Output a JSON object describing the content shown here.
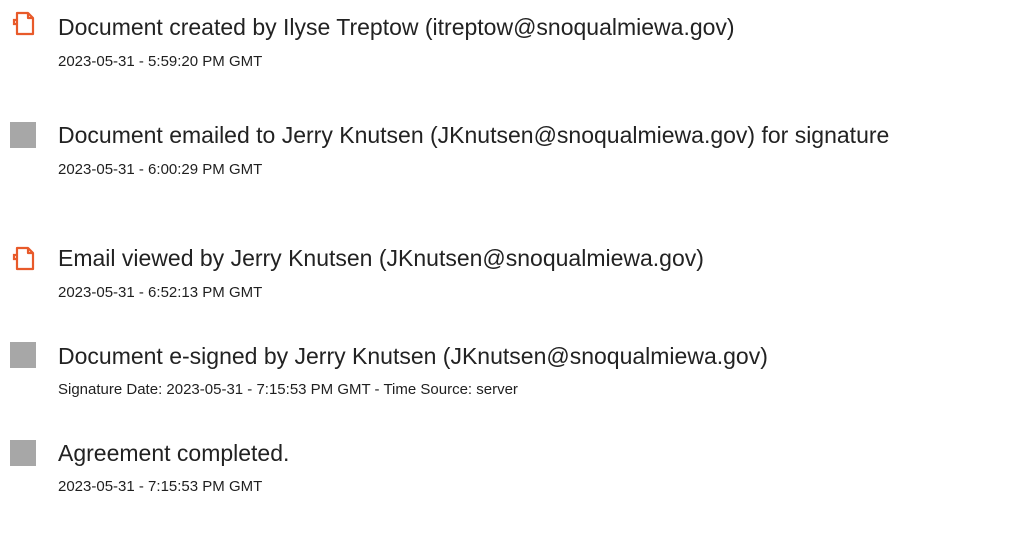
{
  "colors": {
    "doc_icon_accent": "#e85a2a",
    "square_icon": "#a7a7a7",
    "text": "#222222"
  },
  "events": [
    {
      "icon": "document-icon",
      "title": "Document created by Ilyse Treptow (itreptow@snoqualmiewa.gov)",
      "meta": "2023-05-31 - 5:59:20 PM GMT"
    },
    {
      "icon": "gray-square-icon",
      "title": "Document emailed to Jerry Knutsen (JKnutsen@snoqualmiewa.gov) for signature",
      "meta": "2023-05-31 - 6:00:29 PM GMT"
    },
    {
      "icon": "document-icon",
      "title": "Email viewed by Jerry Knutsen (JKnutsen@snoqualmiewa.gov)",
      "meta": "2023-05-31 - 6:52:13 PM GMT"
    },
    {
      "icon": "gray-square-icon",
      "title": "Document e-signed by Jerry Knutsen (JKnutsen@snoqualmiewa.gov)",
      "meta": "Signature Date: 2023-05-31 - 7:15:53 PM GMT - Time Source: server"
    },
    {
      "icon": "gray-square-icon",
      "title": "Agreement completed.",
      "meta": "2023-05-31 - 7:15:53 PM GMT"
    }
  ]
}
